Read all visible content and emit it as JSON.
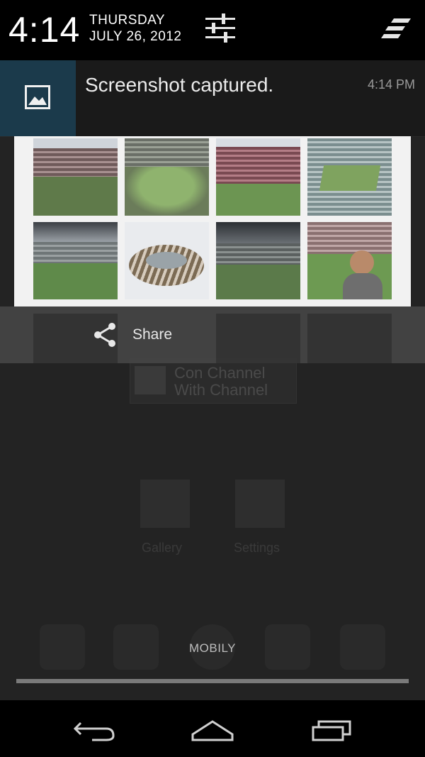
{
  "status": {
    "time": "4:14",
    "day": "THURSDAY",
    "date": "JULY 26, 2012",
    "settings_icon": "quick-settings-icon",
    "clear_icon": "clear-all-icon"
  },
  "notification": {
    "title": "Screenshot captured.",
    "time": "4:14 PM",
    "icon": "image-icon",
    "accent": "#1b3a4b",
    "action": {
      "label": "Share",
      "icon": "share-icon"
    }
  },
  "background": {
    "card_text_1": "Con Channel",
    "card_text_2": "With Channel",
    "apps": [
      "Gallery",
      "Settings"
    ]
  },
  "carrier": "MOBILY",
  "nav": [
    "back-icon",
    "home-icon",
    "recents-icon"
  ]
}
